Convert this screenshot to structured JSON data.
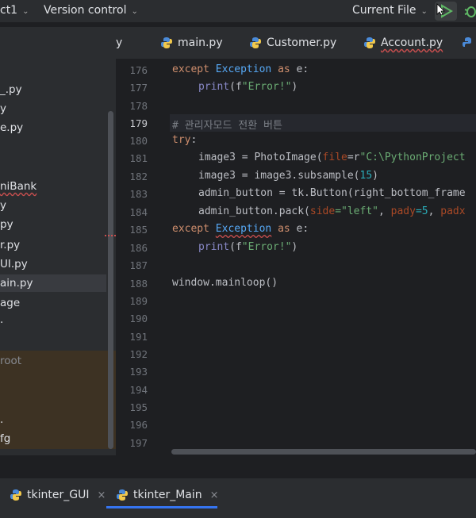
{
  "titlebar": {
    "project_label": "ct1",
    "vcs_label": "Version control",
    "run_config_label": "Current File"
  },
  "editor_tabs": [
    {
      "label": "y"
    },
    {
      "label": "main.py"
    },
    {
      "label": "Customer.py"
    },
    {
      "label": "Account.py"
    }
  ],
  "project_tree": [
    {
      "label": "_.py"
    },
    {
      "label": "y"
    },
    {
      "label": "e.py"
    },
    {
      "label": "niBank"
    },
    {
      "label": "y"
    },
    {
      "label": "py"
    },
    {
      "label": "r.py"
    },
    {
      "label": "UI.py"
    },
    {
      "label": "ain.py"
    },
    {
      "label": "age"
    },
    {
      "label": "."
    },
    {
      "label": "root"
    },
    {
      "label": "."
    },
    {
      "label": "fg"
    }
  ],
  "line_numbers": [
    "176",
    "177",
    "178",
    "179",
    "180",
    "181",
    "182",
    "183",
    "184",
    "185",
    "186",
    "187",
    "188",
    "189",
    "190",
    "191",
    "192",
    "193",
    "194",
    "195",
    "196",
    "197"
  ],
  "code": {
    "l176": {
      "kw": "except",
      "cls": "Exception",
      "kw2": "as",
      "rest": " e:"
    },
    "l177": {
      "fn": "print",
      "open": "(f",
      "str": "\"Error!\"",
      "close": ")"
    },
    "l179": {
      "comment": "# 관리자모드 전환 버튼"
    },
    "l180": {
      "kw": "try",
      "rest": ":"
    },
    "l181": {
      "a": "image3 = PhotoImage(",
      "param": "file",
      "eq": "=r",
      "str": "\"C:\\PythonProject"
    },
    "l182": {
      "a": "image3 = image3.subsample(",
      "num": "15",
      "b": ")"
    },
    "l183": {
      "a": "admin_button = tk.Button(right_bottom_frame"
    },
    "l184": {
      "a": "admin_button.pack(",
      "p1": "side",
      "s1": "=\"left\"",
      "c1": ", ",
      "p2": "pady",
      "n2": "=5",
      "c2": ", ",
      "p3": "padx"
    },
    "l185": {
      "kw": "except",
      "cls": "Exception",
      "kw2": "as",
      "rest": " e:"
    },
    "l186": {
      "fn": "print",
      "open": "(f",
      "str": "\"Error!\"",
      "close": ")"
    },
    "l188": {
      "a": "window.mainloop()"
    }
  },
  "bottom_tabs": [
    {
      "label": "tkinter_GUI",
      "close": "×"
    },
    {
      "label": "tkinter_Main",
      "close": "×"
    }
  ],
  "colors": {
    "background": "#1e1f22",
    "panel": "#2b2d30",
    "keyword": "#cf8e6d",
    "class": "#56a8f5",
    "string": "#6aab73",
    "number": "#2aacb8",
    "accent": "#3574f0"
  },
  "icons": {
    "python_file": "python-icon",
    "run": "run-icon",
    "debug": "debug-icon"
  }
}
